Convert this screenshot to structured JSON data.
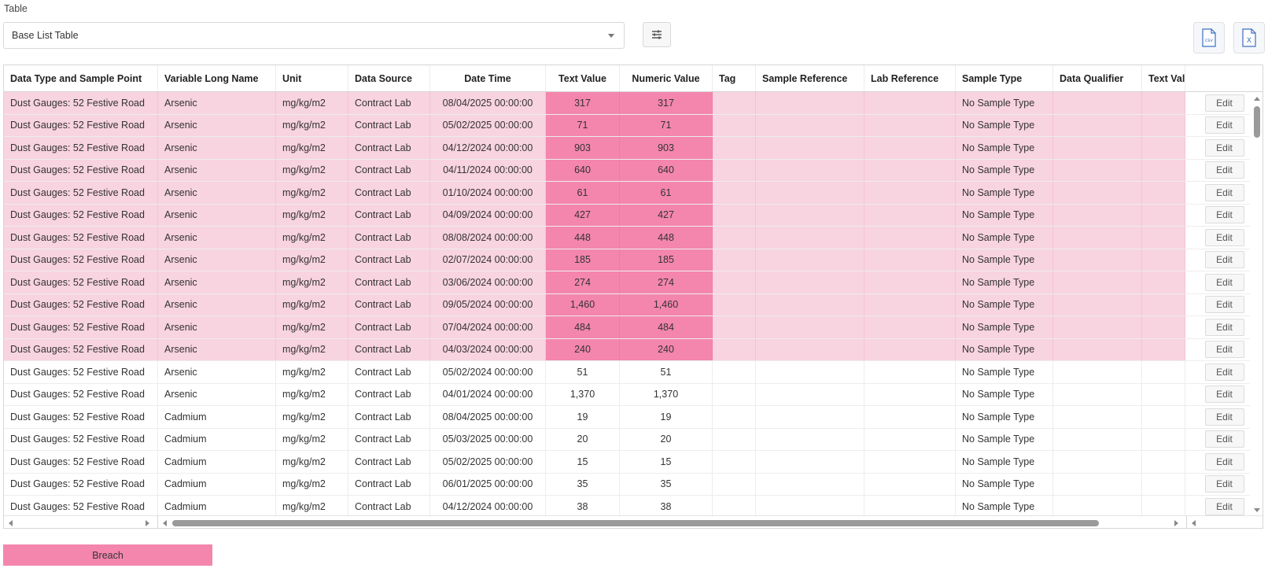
{
  "form": {
    "table_label": "Table",
    "table_select_value": "Base List Table"
  },
  "toolbar": {
    "settings_icon": "sliders-icon",
    "csv_icon": "csv-file-icon",
    "csv_icon_text": "csv",
    "excel_icon": "excel-file-icon",
    "excel_icon_text": "X"
  },
  "grid": {
    "columns": [
      "Data Type and Sample Point",
      "Variable Long Name",
      "Unit",
      "Data Source",
      "Date Time",
      "Text Value",
      "Numeric Value",
      "Tag",
      "Sample Reference",
      "Lab Reference",
      "Sample Type",
      "Data Qualifier",
      "Text Valu",
      ""
    ],
    "edit_label": "Edit",
    "rows": [
      {
        "point": "Dust Gauges: 52 Festive Road",
        "variable": "Arsenic",
        "unit": "mg/kg/m2",
        "source": "Contract Lab",
        "datetime": "08/04/2025 00:00:00",
        "text_value": "317",
        "numeric_value": "317",
        "sample_type": "No Sample Type",
        "breach": true
      },
      {
        "point": "Dust Gauges: 52 Festive Road",
        "variable": "Arsenic",
        "unit": "mg/kg/m2",
        "source": "Contract Lab",
        "datetime": "05/02/2025 00:00:00",
        "text_value": "71",
        "numeric_value": "71",
        "sample_type": "No Sample Type",
        "breach": true
      },
      {
        "point": "Dust Gauges: 52 Festive Road",
        "variable": "Arsenic",
        "unit": "mg/kg/m2",
        "source": "Contract Lab",
        "datetime": "04/12/2024 00:00:00",
        "text_value": "903",
        "numeric_value": "903",
        "sample_type": "No Sample Type",
        "breach": true
      },
      {
        "point": "Dust Gauges: 52 Festive Road",
        "variable": "Arsenic",
        "unit": "mg/kg/m2",
        "source": "Contract Lab",
        "datetime": "04/11/2024 00:00:00",
        "text_value": "640",
        "numeric_value": "640",
        "sample_type": "No Sample Type",
        "breach": true
      },
      {
        "point": "Dust Gauges: 52 Festive Road",
        "variable": "Arsenic",
        "unit": "mg/kg/m2",
        "source": "Contract Lab",
        "datetime": "01/10/2024 00:00:00",
        "text_value": "61",
        "numeric_value": "61",
        "sample_type": "No Sample Type",
        "breach": true
      },
      {
        "point": "Dust Gauges: 52 Festive Road",
        "variable": "Arsenic",
        "unit": "mg/kg/m2",
        "source": "Contract Lab",
        "datetime": "04/09/2024 00:00:00",
        "text_value": "427",
        "numeric_value": "427",
        "sample_type": "No Sample Type",
        "breach": true
      },
      {
        "point": "Dust Gauges: 52 Festive Road",
        "variable": "Arsenic",
        "unit": "mg/kg/m2",
        "source": "Contract Lab",
        "datetime": "08/08/2024 00:00:00",
        "text_value": "448",
        "numeric_value": "448",
        "sample_type": "No Sample Type",
        "breach": true
      },
      {
        "point": "Dust Gauges: 52 Festive Road",
        "variable": "Arsenic",
        "unit": "mg/kg/m2",
        "source": "Contract Lab",
        "datetime": "02/07/2024 00:00:00",
        "text_value": "185",
        "numeric_value": "185",
        "sample_type": "No Sample Type",
        "breach": true
      },
      {
        "point": "Dust Gauges: 52 Festive Road",
        "variable": "Arsenic",
        "unit": "mg/kg/m2",
        "source": "Contract Lab",
        "datetime": "03/06/2024 00:00:00",
        "text_value": "274",
        "numeric_value": "274",
        "sample_type": "No Sample Type",
        "breach": true
      },
      {
        "point": "Dust Gauges: 52 Festive Road",
        "variable": "Arsenic",
        "unit": "mg/kg/m2",
        "source": "Contract Lab",
        "datetime": "09/05/2024 00:00:00",
        "text_value": "1,460",
        "numeric_value": "1,460",
        "sample_type": "No Sample Type",
        "breach": true
      },
      {
        "point": "Dust Gauges: 52 Festive Road",
        "variable": "Arsenic",
        "unit": "mg/kg/m2",
        "source": "Contract Lab",
        "datetime": "07/04/2024 00:00:00",
        "text_value": "484",
        "numeric_value": "484",
        "sample_type": "No Sample Type",
        "breach": true
      },
      {
        "point": "Dust Gauges: 52 Festive Road",
        "variable": "Arsenic",
        "unit": "mg/kg/m2",
        "source": "Contract Lab",
        "datetime": "04/03/2024 00:00:00",
        "text_value": "240",
        "numeric_value": "240",
        "sample_type": "No Sample Type",
        "breach": true
      },
      {
        "point": "Dust Gauges: 52 Festive Road",
        "variable": "Arsenic",
        "unit": "mg/kg/m2",
        "source": "Contract Lab",
        "datetime": "05/02/2024 00:00:00",
        "text_value": "51",
        "numeric_value": "51",
        "sample_type": "No Sample Type",
        "breach": false
      },
      {
        "point": "Dust Gauges: 52 Festive Road",
        "variable": "Arsenic",
        "unit": "mg/kg/m2",
        "source": "Contract Lab",
        "datetime": "04/01/2024 00:00:00",
        "text_value": "1,370",
        "numeric_value": "1,370",
        "sample_type": "No Sample Type",
        "breach": false
      },
      {
        "point": "Dust Gauges: 52 Festive Road",
        "variable": "Cadmium",
        "unit": "mg/kg/m2",
        "source": "Contract Lab",
        "datetime": "08/04/2025 00:00:00",
        "text_value": "19",
        "numeric_value": "19",
        "sample_type": "No Sample Type",
        "breach": false
      },
      {
        "point": "Dust Gauges: 52 Festive Road",
        "variable": "Cadmium",
        "unit": "mg/kg/m2",
        "source": "Contract Lab",
        "datetime": "05/03/2025 00:00:00",
        "text_value": "20",
        "numeric_value": "20",
        "sample_type": "No Sample Type",
        "breach": false
      },
      {
        "point": "Dust Gauges: 52 Festive Road",
        "variable": "Cadmium",
        "unit": "mg/kg/m2",
        "source": "Contract Lab",
        "datetime": "05/02/2025 00:00:00",
        "text_value": "15",
        "numeric_value": "15",
        "sample_type": "No Sample Type",
        "breach": false
      },
      {
        "point": "Dust Gauges: 52 Festive Road",
        "variable": "Cadmium",
        "unit": "mg/kg/m2",
        "source": "Contract Lab",
        "datetime": "06/01/2025 00:00:00",
        "text_value": "35",
        "numeric_value": "35",
        "sample_type": "No Sample Type",
        "breach": false
      },
      {
        "point": "Dust Gauges: 52 Festive Road",
        "variable": "Cadmium",
        "unit": "mg/kg/m2",
        "source": "Contract Lab",
        "datetime": "04/12/2024 00:00:00",
        "text_value": "38",
        "numeric_value": "38",
        "sample_type": "No Sample Type",
        "breach": false
      }
    ]
  },
  "legend": {
    "breach_label": "Breach",
    "breach_color": "#f486ad",
    "breach_row_color": "#f8d3e0"
  }
}
